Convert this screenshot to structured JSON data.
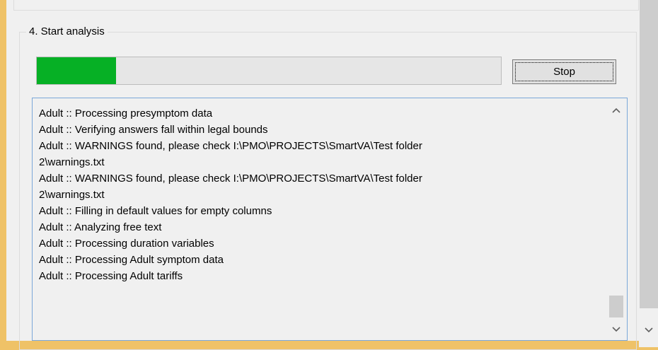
{
  "section": {
    "title": "4. Start analysis"
  },
  "progress": {
    "value": 0.17,
    "color": "#06b025"
  },
  "stop_button": {
    "label": "Stop"
  },
  "log": {
    "lines": [
      "Adult :: Processing presymptom data",
      "Adult :: Verifying answers fall within legal bounds",
      "Adult :: WARNINGS found, please check I:\\PMO\\PROJECTS\\SmartVA\\Test folder",
      "2\\warnings.txt",
      "Adult :: WARNINGS found, please check I:\\PMO\\PROJECTS\\SmartVA\\Test folder",
      "2\\warnings.txt",
      "Adult :: Filling in default values for empty columns",
      "Adult :: Analyzing free text",
      "Adult :: Processing duration variables",
      "Adult :: Processing Adult symptom data",
      "Adult :: Processing Adult tariffs"
    ]
  },
  "icons": {
    "log_scroll_up": "chevron-up-icon",
    "log_scroll_down": "chevron-down-icon",
    "window_scroll_down": "chevron-down-icon"
  },
  "colors": {
    "window_frame": "#efc267",
    "client_background": "#f0f0f0",
    "log_border": "#7aa7d9",
    "scroll_thumb": "#cdcdcd"
  }
}
